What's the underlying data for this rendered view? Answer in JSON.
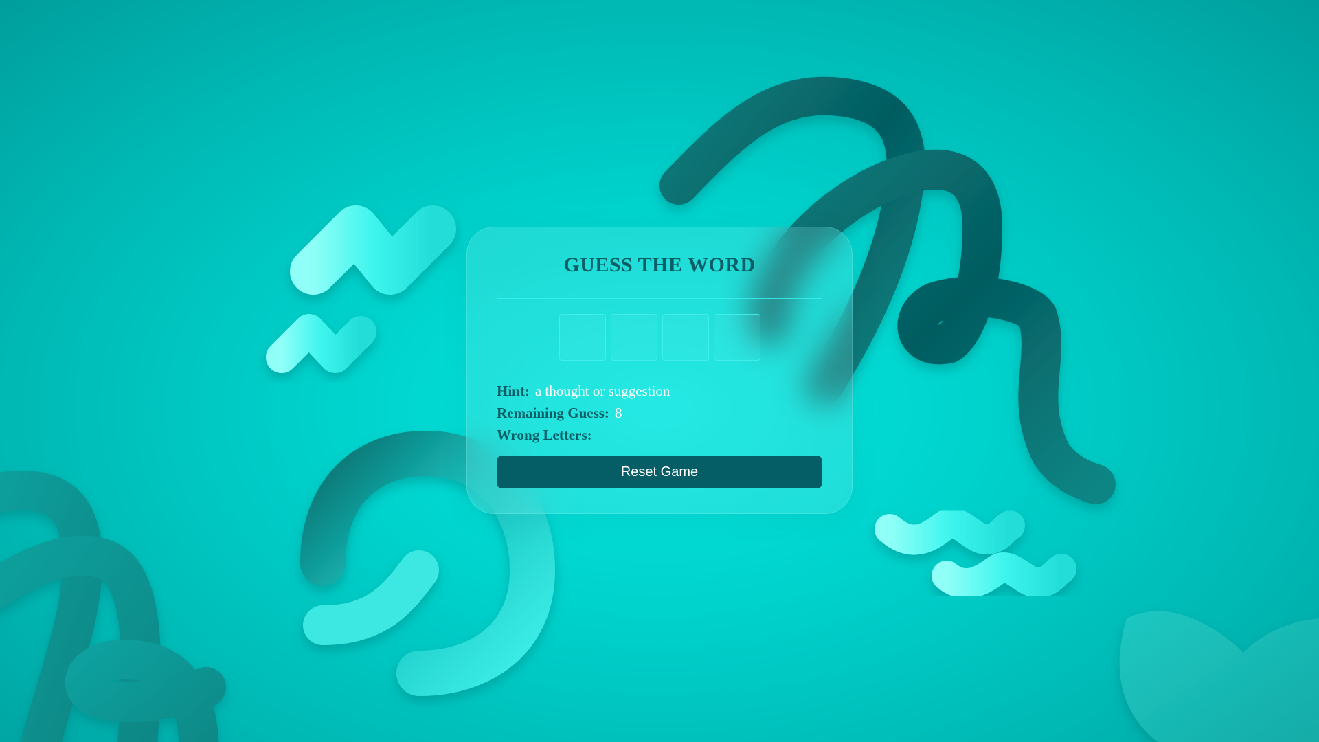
{
  "game": {
    "title": "GUESS THE WORD",
    "slots": [
      "",
      "",
      "",
      ""
    ],
    "hint": {
      "label": "Hint:",
      "value": "a thought or suggestion"
    },
    "remaining": {
      "label": "Remaining Guess:",
      "value": "8"
    },
    "wrong": {
      "label": "Wrong Letters:",
      "value": ""
    },
    "reset_label": "Reset Game"
  },
  "theme": {
    "background": "#00d2cc",
    "accent_dark": "#055d66",
    "slot_border": "#46f0eb"
  },
  "decorations": [
    "dark-teal-tube-shape",
    "light-cyan-zigzag-shape",
    "cyan-ring-shape",
    "cyan-wave-shape",
    "blob-shape"
  ]
}
